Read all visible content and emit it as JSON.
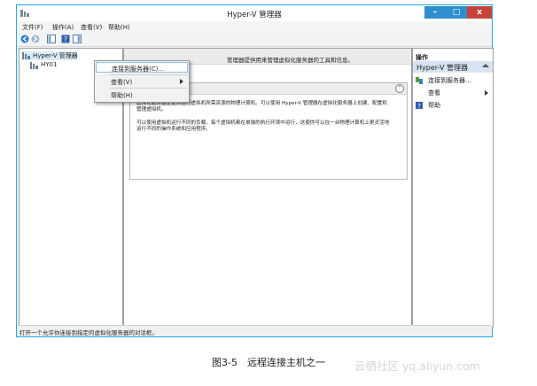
{
  "window": {
    "title": "Hyper-V 管理器",
    "controls": {
      "minimize": "–",
      "maximize": "□",
      "close": "x"
    }
  },
  "menu": [
    "文件(F)",
    "操作(A)",
    "查看(V)",
    "帮助(H)"
  ],
  "toolbar_icons": [
    "back-arrow-icon",
    "forward-arrow-icon",
    "show-tree-icon",
    "help-icon",
    "action-pane-icon"
  ],
  "tree": {
    "root": "Hyper-V 管理器",
    "child": "HY01"
  },
  "center": {
    "description": "管理器提供用来管理虚拟化服务器的工具和信息。",
    "paragraph1": "虚拟化服务器是提供运行虚拟机所需资源的物理计算机。可以使用 Hyper-V 管理器在虚拟化服务器上创建、配置和管理虚拟机。",
    "paragraph2": "可以使用虚拟机运行不同的负载。每个虚拟机都在单独的执行环境中运行，这使你可以在一台物理计算机上更灵活地运行不同的操作系统和应用程序。"
  },
  "actions": {
    "header": "操作",
    "group": "Hyper-V 管理器",
    "items": [
      {
        "label": "连接到服务器...",
        "icon": "connect-server-icon"
      },
      {
        "label": "查看",
        "icon": "",
        "submenu": true
      },
      {
        "label": "帮助",
        "icon": "help-icon"
      }
    ]
  },
  "context_menu": {
    "items": [
      {
        "label": "连接到服务器(C)...",
        "highlighted": true
      },
      {
        "label": "查看(V)",
        "submenu": true
      },
      {
        "label": "帮助(H)"
      }
    ]
  },
  "status": "打开一个允许你连接到指定的虚拟化服务器的对话框。",
  "caption": "图3-5　远程连接主机之一",
  "watermark": "云栖社区 yq.aliyun.com",
  "colors": {
    "window_border": "#23a9dd",
    "action_group_bg": "#d7e5f2",
    "close_button": "#c7433a"
  }
}
